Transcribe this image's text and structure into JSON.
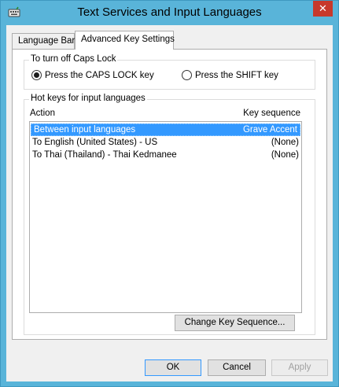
{
  "window": {
    "title": "Text Services and Input Languages",
    "close_symbol": "✕",
    "accent_color": "#59b4d9"
  },
  "tabs": [
    {
      "label": "Language Bar",
      "active": false
    },
    {
      "label": "Advanced Key Settings",
      "active": true
    }
  ],
  "caps_lock": {
    "legend": "To turn off Caps Lock",
    "options": [
      {
        "label": "Press the CAPS LOCK key",
        "checked": true
      },
      {
        "label": "Press the SHIFT key",
        "checked": false
      }
    ]
  },
  "hotkeys": {
    "legend": "Hot keys for input languages",
    "col_action": "Action",
    "col_key": "Key sequence",
    "items": [
      {
        "action": "Between input languages",
        "key": "Grave Accent",
        "selected": true
      },
      {
        "action": "To English (United States) - US",
        "key": "(None)",
        "selected": false
      },
      {
        "action": "To Thai (Thailand) - Thai Kedmanee",
        "key": "(None)",
        "selected": false
      }
    ],
    "change_button": "Change Key Sequence..."
  },
  "buttons": {
    "ok": "OK",
    "cancel": "Cancel",
    "apply": "Apply"
  },
  "icons": {
    "app": "keyboard-icon",
    "close": "close-icon"
  }
}
